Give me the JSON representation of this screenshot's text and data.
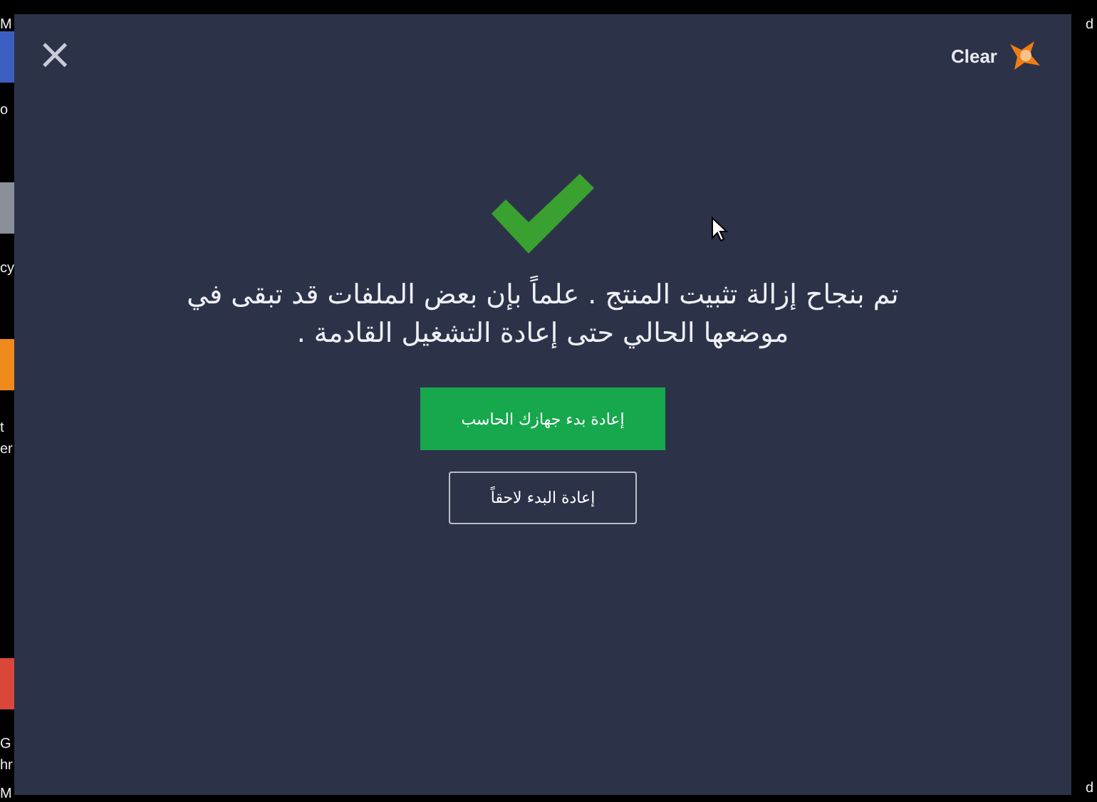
{
  "desktop": {
    "left_labels": [
      "M",
      "o",
      "cy",
      "t",
      "er",
      "G",
      "hr",
      "M"
    ],
    "right_labels": [
      "d",
      "d"
    ]
  },
  "window": {
    "close": "×",
    "brand": "Clear"
  },
  "message": "تم بنجاح إزالة تثبيت المنتج . علماً بإن بعض الملفات قد تبقى في موضعها الحالي حتى إعادة التشغيل القادمة .",
  "buttons": [
    {
      "label": "إعادة بدء جهازك الحاسب",
      "kind": "primary"
    },
    {
      "label": "إعادة البدء لاحقاً",
      "kind": "outline"
    }
  ]
}
